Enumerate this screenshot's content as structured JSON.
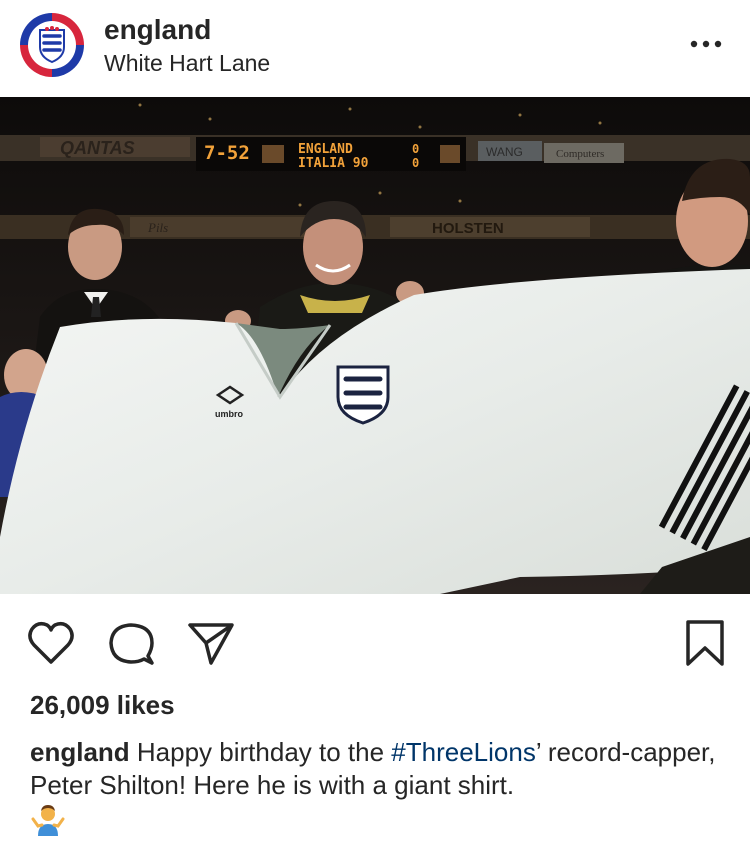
{
  "post": {
    "username": "england",
    "location": "White Hart Lane",
    "likes": "26,009 likes",
    "caption": {
      "username": "england",
      "text_before": " Happy birthday to the ",
      "hashtag": "#ThreeLions",
      "text_after": "’ record-capper, Peter Shilton! Here he is with a giant shirt."
    }
  },
  "photo": {
    "scoreboard_time": "7-52",
    "scoreboard_team1": "ENGLAND",
    "scoreboard_team2": "ITALIA 90",
    "scoreboard_score1": "0",
    "scoreboard_score2": "0",
    "ad_qantas": "QANTAS",
    "ad_wang": "WANG",
    "ad_computers": "Computers",
    "ad_holsten": "HOLSTEN",
    "ad_pils": "Pils",
    "shirt_brand": "umbro"
  },
  "icons": {
    "more": "more-options-icon",
    "like": "heart-icon",
    "comment": "comment-icon",
    "share": "paper-plane-icon",
    "save": "bookmark-icon",
    "emoji": "person-shrugging-emoji"
  },
  "colors": {
    "text": "#262626",
    "hashtag": "#003569",
    "avatar_red": "#d7263d",
    "avatar_blue": "#1e3aa8"
  }
}
